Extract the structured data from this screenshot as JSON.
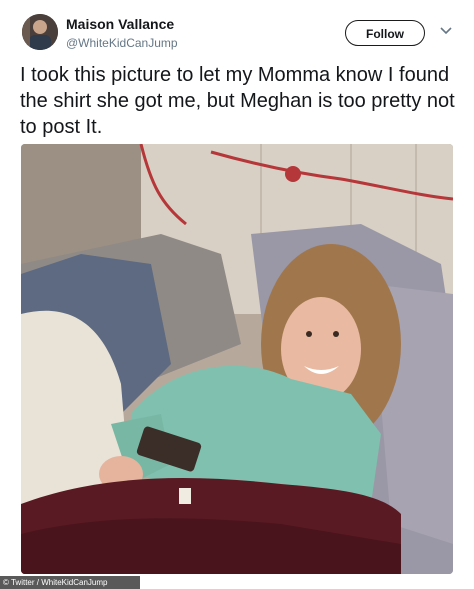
{
  "tweet": {
    "author_name": "Maison Vallance",
    "author_handle": "@WhiteKidCanJump",
    "follow_label": "Follow",
    "text": "I took this picture to let my Momma know I found the shirt she got me, but Meghan is too pretty not to post It."
  },
  "icons": {
    "menu": "chevron-down-icon"
  },
  "watermark": {
    "text": "© Twitter / WhiteKidCanJump"
  },
  "colors": {
    "follow_border": "#1b1b1b",
    "handle_gray": "#657786",
    "text": "#14171a"
  }
}
